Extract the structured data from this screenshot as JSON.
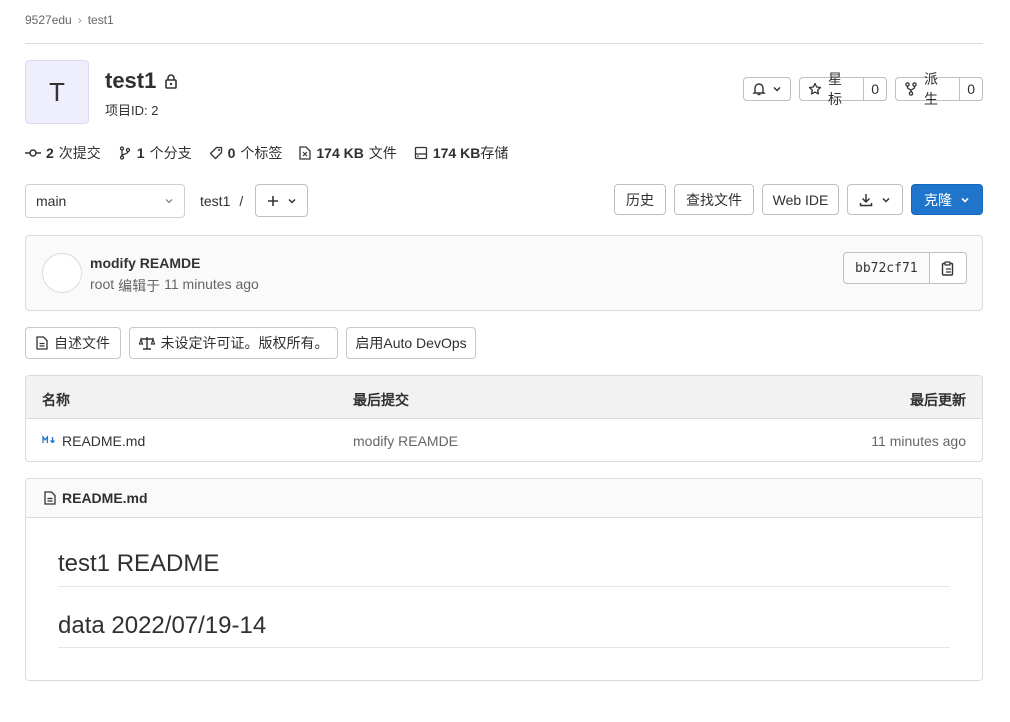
{
  "breadcrumb": {
    "group": "9527edu",
    "separator": "›",
    "project": "test1"
  },
  "project": {
    "avatar_letter": "T",
    "name": "test1",
    "id_label": "项目ID: 2",
    "star_label": "星标",
    "star_count": "0",
    "fork_label": "派生",
    "fork_count": "0"
  },
  "stats": {
    "commits_num": "2",
    "commits_label": "次提交",
    "branches_num": "1",
    "branches_label": "个分支",
    "tags_num": "0",
    "tags_label": "个标签",
    "files_num": "174 KB",
    "files_label": "文件",
    "storage_num": "174 KB",
    "storage_label": "存储"
  },
  "toolbar": {
    "branch": "main",
    "path": "test1",
    "path_sep": "/",
    "history": "历史",
    "find_file": "查找文件",
    "web_ide": "Web IDE",
    "clone": "克隆"
  },
  "last_commit": {
    "message": "modify REAMDE",
    "author": "root",
    "authored_label": "编辑于",
    "time": "11 minutes ago",
    "sha": "bb72cf71"
  },
  "quick_actions": {
    "readme": "自述文件",
    "license": "未设定许可证。版权所有。",
    "devops": "启用Auto DevOps"
  },
  "file_table": {
    "headers": {
      "name": "名称",
      "last_commit": "最后提交",
      "last_update": "最后更新"
    },
    "rows": [
      {
        "name": "README.md",
        "commit": "modify REAMDE",
        "updated": "11 minutes ago"
      }
    ]
  },
  "readme": {
    "filename": "README.md",
    "heading1": "test1 README",
    "heading2": "data 2022/07/19-14"
  },
  "colors": {
    "primary": "#1f75cb",
    "avatar_bg": "#eeeefd",
    "border": "#dbdbdb",
    "panel_bg": "#fafafa"
  }
}
